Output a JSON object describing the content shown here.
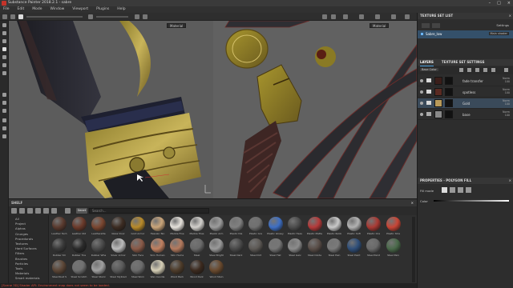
{
  "window": {
    "title": "Substance Painter 2018.2.1 - sabre"
  },
  "menu": [
    "File",
    "Edit",
    "Mode",
    "Window",
    "Viewport",
    "Plugins",
    "Help"
  ],
  "viewport2d": {
    "dropdown": "Material"
  },
  "viewport3d": {
    "dropdown": "Material"
  },
  "shelf": {
    "title": "SHELF",
    "search_tag": "Smart",
    "search_placeholder": "Search...",
    "categories": [
      "All",
      "Project",
      "Alphas",
      "Grunges",
      "Procedurals",
      "Textures",
      "Hard Surfaces",
      "Filters",
      "Brushes",
      "Particles",
      "Tools",
      "Materials",
      "Smart materials"
    ],
    "materials": [
      {
        "label": "Leather Tech",
        "color": "#5a3a2e"
      },
      {
        "label": "Leather Old",
        "color": "#6b3a2a"
      },
      {
        "label": "Leatherette",
        "color": "#7a4630"
      },
      {
        "label": "Glass Visor",
        "color": "#3c2c22"
      },
      {
        "label": "Gold Armor",
        "color": "#b88a2a"
      },
      {
        "label": "Hessian Tan",
        "color": "#caa57a"
      },
      {
        "label": "Marble Fine",
        "color": "#e6e2dc"
      },
      {
        "label": "Marble Tiles",
        "color": "#d2d0cc"
      },
      {
        "label": "Plastic Arm",
        "color": "#9c9c9c"
      },
      {
        "label": "Plastic Dia",
        "color": "#808080"
      },
      {
        "label": "Plastic Gra",
        "color": "#707070"
      },
      {
        "label": "Plastic Glossy",
        "color": "#3e6fc4"
      },
      {
        "label": "Plastic Heav",
        "color": "#4d4d4d"
      },
      {
        "label": "Plastic Matte",
        "color": "#b53a3a"
      },
      {
        "label": "Plastic Rubb",
        "color": "#c9c9c9"
      },
      {
        "label": "Plastic Soft",
        "color": "#b2b2b2"
      },
      {
        "label": "Plastic Ora",
        "color": "#a93a34"
      },
      {
        "label": "Plastic Stra",
        "color": "#c84536"
      },
      {
        "label": "Rubber Str",
        "color": "#3a3a3a"
      },
      {
        "label": "Rubber Tire",
        "color": "#2a2a2a"
      },
      {
        "label": "Rubber Whe",
        "color": "#4a4a4a"
      },
      {
        "label": "Silver Armor",
        "color": "#bcbcbc"
      },
      {
        "label": "Skin Face",
        "color": "#8a5a48"
      },
      {
        "label": "Skin Human",
        "color": "#c08060"
      },
      {
        "label": "Skin Huma",
        "color": "#b47a5e"
      },
      {
        "label": "Steel",
        "color": "#6a6a6a"
      },
      {
        "label": "Steel Bright",
        "color": "#9a9a9a"
      },
      {
        "label": "Steel Dark",
        "color": "#4a4a4a"
      },
      {
        "label": "Steel Dirt",
        "color": "#5e5a56"
      },
      {
        "label": "Steel Flat",
        "color": "#767676"
      },
      {
        "label": "Steel Galv",
        "color": "#8c8c8c"
      },
      {
        "label": "Steel Oxide",
        "color": "#5a4e48"
      },
      {
        "label": "Steel Pain",
        "color": "#7a7a7a"
      },
      {
        "label": "Steel Paint",
        "color": "#2f4f7a"
      },
      {
        "label": "Steel Paint",
        "color": "#6a6a6a"
      },
      {
        "label": "Steel Pain",
        "color": "#4a6a4a"
      },
      {
        "label": "Steel Rust S",
        "color": "#5c4636"
      },
      {
        "label": "Steel Scratch",
        "color": "#707070"
      },
      {
        "label": "Steel Stainl",
        "color": "#a0a0a0"
      },
      {
        "label": "Steel Stylized",
        "color": "#5a5a5a"
      },
      {
        "label": "Steel Worn",
        "color": "#6c6c6c"
      },
      {
        "label": "Wax Candle",
        "color": "#d6cfb6"
      },
      {
        "label": "Wood Bark",
        "color": "#4e3c2a"
      },
      {
        "label": "Wood Dark",
        "color": "#3c2a1e"
      },
      {
        "label": "Wood Stain",
        "color": "#6a4a2e"
      }
    ]
  },
  "status": "[Scene 3D] Shader API: Environment map does not seem to be loaded.",
  "texture_set_list": {
    "title": "TEXTURE SET LIST",
    "settings": "Settings",
    "row": {
      "name": "Sabre_low",
      "shader": "Main shader"
    }
  },
  "layers": {
    "tabs": [
      "LAYERS",
      "TEXTURE SET SETTINGS"
    ],
    "blend_mode": "Base Color",
    "rows": [
      {
        "name": "fade transfer",
        "blend": "Norm",
        "opacity": "100",
        "color": "#3a1e1a",
        "type": "folder"
      },
      {
        "name": "spotless",
        "blend": "Norm",
        "opacity": "100",
        "color": "#5a2a22",
        "type": "folder"
      },
      {
        "name": "Gold",
        "blend": "Norm",
        "opacity": "100",
        "color": "#b89a5a",
        "type": "folder"
      },
      {
        "name": "base",
        "blend": "Norm",
        "opacity": "100",
        "color": "#888888",
        "type": "fill"
      }
    ]
  },
  "properties": {
    "title": "PROPERTIES - POLYGON FILL",
    "fill_mode": "Fill mode",
    "color_label": "Color"
  }
}
